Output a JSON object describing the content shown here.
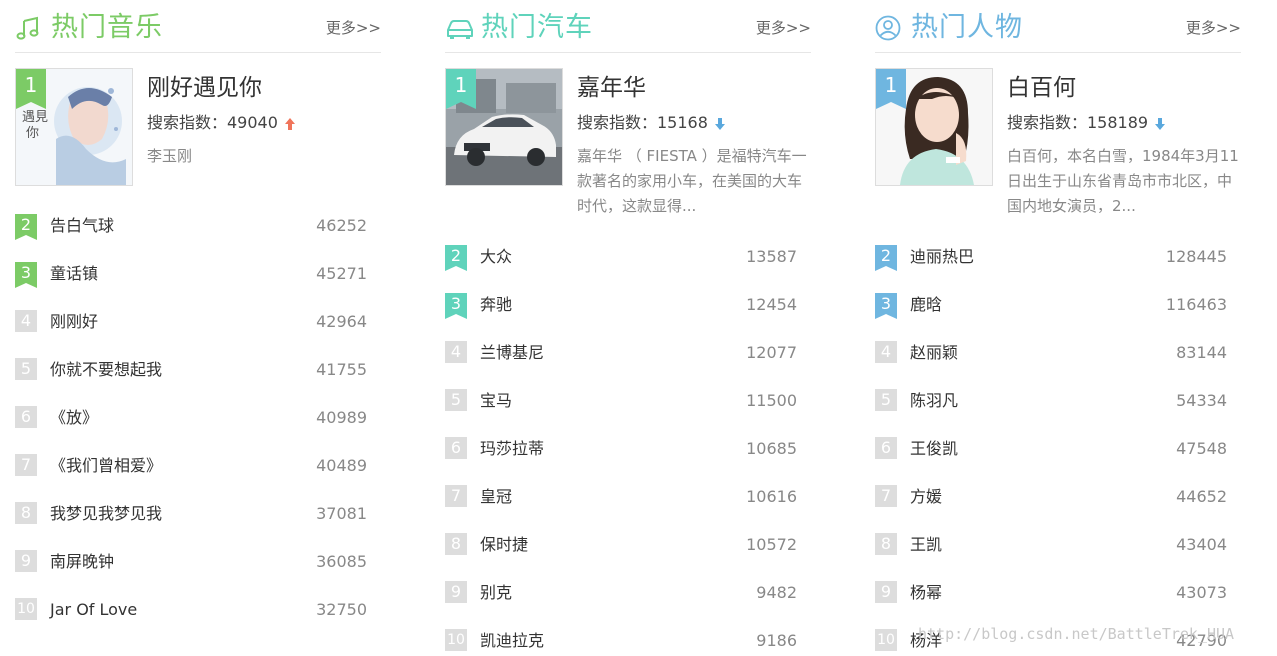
{
  "accent_colors": {
    "music": "#7ccb66",
    "cars": "#5fd3bb",
    "people": "#6fb6e0",
    "rank_gray": "#dddddd",
    "trend_up": "#f0745a",
    "trend_down": "#5aa8dd"
  },
  "panels": [
    {
      "title": "热门音乐",
      "icon": "music-note-icon",
      "more": "更多>>",
      "top": {
        "rank": "1",
        "name": "刚好遇见你",
        "index_label": "搜索指数：49040",
        "trend": "up",
        "desc": "李玉刚",
        "image": "album-cover"
      },
      "items": [
        {
          "rank": "2",
          "name": "告白气球",
          "value": "46252"
        },
        {
          "rank": "3",
          "name": "童话镇",
          "value": "45271"
        },
        {
          "rank": "4",
          "name": "刚刚好",
          "value": "42964"
        },
        {
          "rank": "5",
          "name": "你就不要想起我",
          "value": "41755"
        },
        {
          "rank": "6",
          "name": "《放》",
          "value": "40989"
        },
        {
          "rank": "7",
          "name": "《我们曾相爱》",
          "value": "40489"
        },
        {
          "rank": "8",
          "name": "我梦见我梦见我",
          "value": "37081"
        },
        {
          "rank": "9",
          "name": "南屏晚钟",
          "value": "36085"
        },
        {
          "rank": "10",
          "name": "Jar Of Love",
          "value": "32750"
        }
      ]
    },
    {
      "title": "热门汽车",
      "icon": "car-icon",
      "more": "更多>>",
      "top": {
        "rank": "1",
        "name": "嘉年华",
        "index_label": "搜索指数：15168",
        "trend": "down",
        "desc": "嘉年华 （ FIESTA ）是福特汽车一款著名的家用小车，在美国的大车时代，这款显得...",
        "image": "car-photo"
      },
      "items": [
        {
          "rank": "2",
          "name": "大众",
          "value": "13587"
        },
        {
          "rank": "3",
          "name": "奔驰",
          "value": "12454"
        },
        {
          "rank": "4",
          "name": "兰博基尼",
          "value": "12077"
        },
        {
          "rank": "5",
          "name": "宝马",
          "value": "11500"
        },
        {
          "rank": "6",
          "name": "玛莎拉蒂",
          "value": "10685"
        },
        {
          "rank": "7",
          "name": "皇冠",
          "value": "10616"
        },
        {
          "rank": "8",
          "name": "保时捷",
          "value": "10572"
        },
        {
          "rank": "9",
          "name": "别克",
          "value": "9482"
        },
        {
          "rank": "10",
          "name": "凯迪拉克",
          "value": "9186"
        }
      ]
    },
    {
      "title": "热门人物",
      "icon": "person-icon",
      "more": "更多>>",
      "top": {
        "rank": "1",
        "name": "白百何",
        "index_label": "搜索指数：158189",
        "trend": "down",
        "desc": "白百何，本名白雪，1984年3月11日出生于山东省青岛市市北区，中国内地女演员，2...",
        "image": "portrait-photo"
      },
      "items": [
        {
          "rank": "2",
          "name": "迪丽热巴",
          "value": "128445"
        },
        {
          "rank": "3",
          "name": "鹿晗",
          "value": "116463"
        },
        {
          "rank": "4",
          "name": "赵丽颖",
          "value": "83144"
        },
        {
          "rank": "5",
          "name": "陈羽凡",
          "value": "54334"
        },
        {
          "rank": "6",
          "name": "王俊凯",
          "value": "47548"
        },
        {
          "rank": "7",
          "name": "方媛",
          "value": "44652"
        },
        {
          "rank": "8",
          "name": "王凯",
          "value": "43404"
        },
        {
          "rank": "9",
          "name": "杨幂",
          "value": "43073"
        },
        {
          "rank": "10",
          "name": "杨洋",
          "value": "42790"
        }
      ]
    }
  ],
  "watermark": "http://blog.csdn.net/BattleTrek_HUA"
}
